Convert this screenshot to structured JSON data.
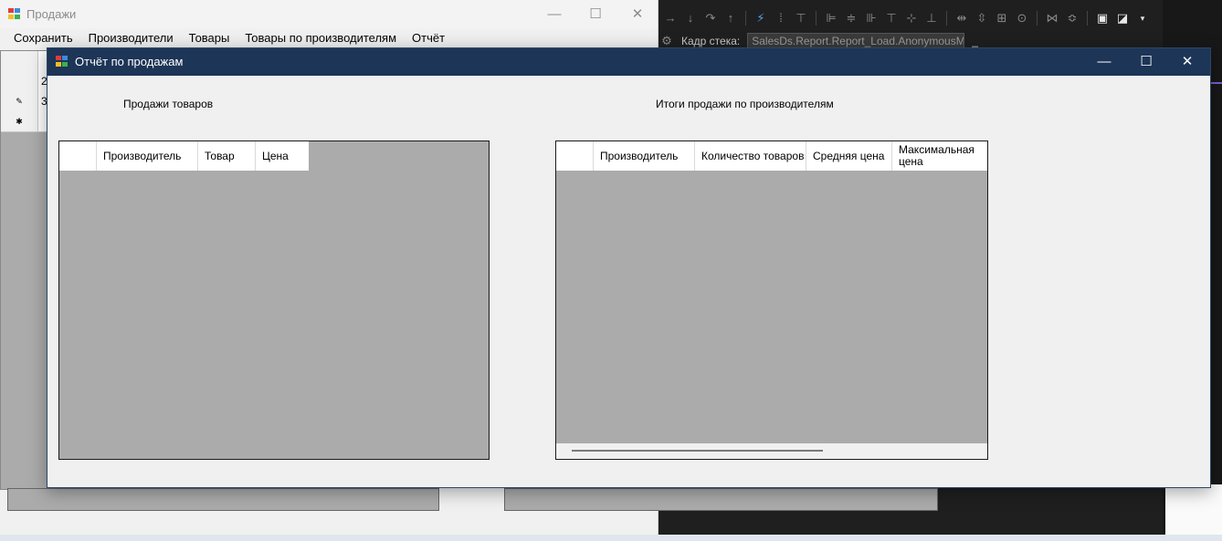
{
  "main_window": {
    "title": "Продажи",
    "menu": [
      "Сохранить",
      "Производители",
      "Товары",
      "Товары по производителям",
      "Отчёт"
    ],
    "grid_rows": [
      {
        "marker": "",
        "value": "2"
      },
      {
        "marker": "✎",
        "value": "3"
      },
      {
        "marker": "✱",
        "value": ""
      }
    ]
  },
  "ide": {
    "stack_label": "Кадр стека:",
    "stack_value": "SalesDs.Report.Report_Load.AnonymousM",
    "stack_dropdown_icon": "▾"
  },
  "report_window": {
    "title": "Отчёт по продажам",
    "caption_buttons": {
      "minimize": "—",
      "maximize": "☐",
      "close": "✕"
    },
    "sales_label": "Продажи товаров",
    "summary_label": "Итоги продажи по производителям",
    "sales_grid": {
      "columns": [
        "",
        "Производитель",
        "Товар",
        "Цена"
      ]
    },
    "summary_grid": {
      "columns": [
        "",
        "Производитель",
        "Количество товаров",
        "Средняя цена",
        "Максимальная цена"
      ]
    }
  },
  "colors": {
    "report_title_bar": "#1d3557",
    "grid_background": "#ababab",
    "ide_background": "#1f1f1f"
  },
  "icons": [
    "app-icon",
    "minimize-icon",
    "maximize-icon",
    "close-icon",
    "row-edit-icon",
    "new-row-icon"
  ]
}
